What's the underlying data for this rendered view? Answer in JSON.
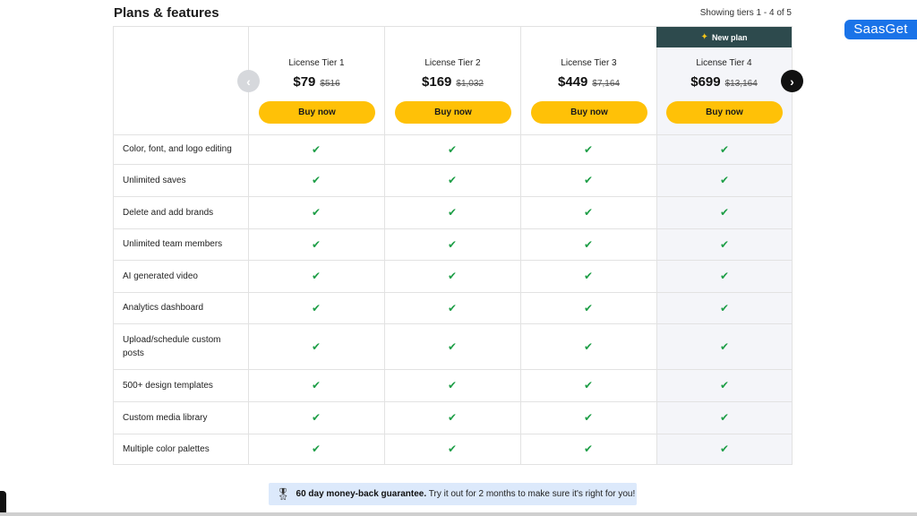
{
  "header": {
    "title": "Plans & features",
    "showing": "Showing tiers 1 - 4 of 5"
  },
  "brand_badge": "SaasGet",
  "new_plan_label": "New plan",
  "tiers": [
    {
      "name": "License Tier 1",
      "price": "$79",
      "old_price": "$516",
      "button": "Buy now"
    },
    {
      "name": "License Tier 2",
      "price": "$169",
      "old_price": "$1,032",
      "button": "Buy now"
    },
    {
      "name": "License Tier 3",
      "price": "$449",
      "old_price": "$7,164",
      "button": "Buy now"
    },
    {
      "name": "License Tier 4",
      "price": "$699",
      "old_price": "$13,164",
      "button": "Buy now"
    }
  ],
  "features": [
    "Color, font, and logo editing",
    "Unlimited saves",
    "Delete and add brands",
    "Unlimited team members",
    "AI generated video",
    "Analytics dashboard",
    "Upload/schedule custom posts",
    "500+ design templates",
    "Custom media library",
    "Multiple color palettes"
  ],
  "check_glyph": "✔",
  "nav": {
    "prev": "‹",
    "next": "›"
  },
  "guarantee": {
    "bold": "60 day money-back guarantee.",
    "text": "Try it out for 2 months to make sure it's right for you!"
  },
  "colors": {
    "accent_button": "#ffc107",
    "check": "#1e9e47",
    "new_plan_bg": "#2d4a4d",
    "badge_bg": "#1a73e8",
    "guarantee_bg": "#dce9fb"
  }
}
